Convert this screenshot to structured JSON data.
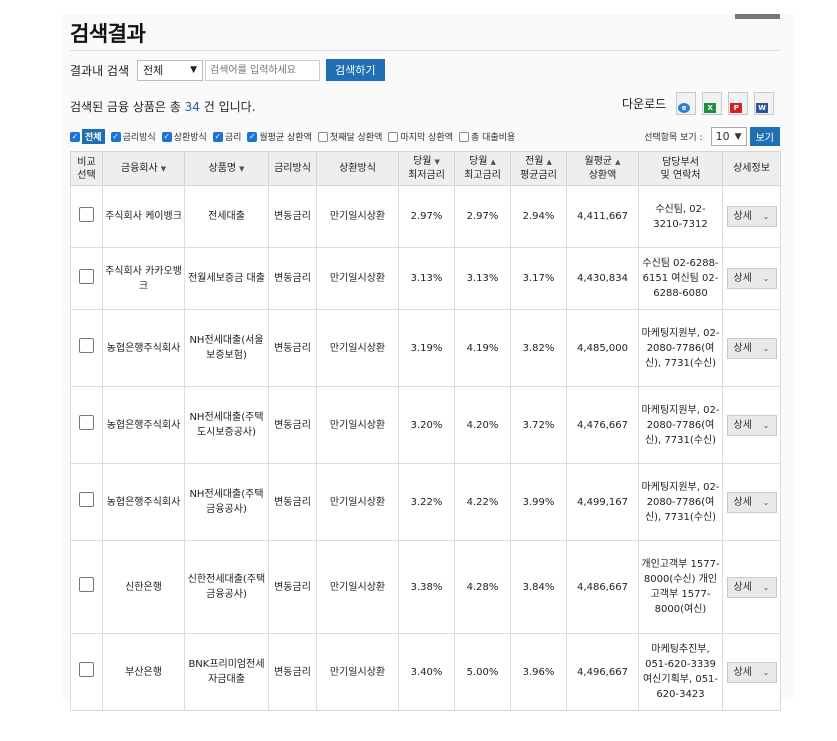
{
  "page": {
    "title": "검색결과"
  },
  "inner_search": {
    "label": "결과내 검색",
    "scope_value": "전체",
    "placeholder": "검색어를 입력하세요",
    "button": "검색하기"
  },
  "summary": {
    "prefix": "검색된 금융 상품은 총 ",
    "count": "34",
    "suffix": " 건 입니다."
  },
  "download": {
    "label": "다운로드",
    "icons": [
      "ie-icon",
      "excel-icon",
      "pdf-icon",
      "word-icon"
    ]
  },
  "filters": [
    {
      "label": "전체",
      "checked": true
    },
    {
      "label": "금리방식",
      "checked": true
    },
    {
      "label": "상환방식",
      "checked": true
    },
    {
      "label": "금리",
      "checked": true
    },
    {
      "label": "월평균 상환액",
      "checked": true
    },
    {
      "label": "첫째달 상환액",
      "checked": false
    },
    {
      "label": "마지막 상환액",
      "checked": false
    },
    {
      "label": "총 대출비용",
      "checked": false
    }
  ],
  "view": {
    "label": "선택항목 보기 :",
    "value": "10",
    "button": "보기"
  },
  "columns": {
    "compare": [
      "비교",
      "선택"
    ],
    "company": "금융회사",
    "product": "상품명",
    "rate_type": "금리방식",
    "repay_type": "상환방식",
    "min_rate": [
      "당월",
      "최저금리"
    ],
    "max_rate": [
      "당월",
      "최고금리"
    ],
    "avg_rate": [
      "전월",
      "평균금리"
    ],
    "monthly": [
      "월평균",
      "상환액"
    ],
    "contact": [
      "담당부서",
      "및 연락처"
    ],
    "detail": "상세정보"
  },
  "rows": [
    {
      "company": "주식회사 케이뱅크",
      "product": "전세대출",
      "rate_type": "변동금리",
      "repay_type": "만기일시상환",
      "min_rate": "2.97%",
      "max_rate": "2.97%",
      "avg_rate": "2.94%",
      "monthly": "4,411,667",
      "contact": "수신팀, 02-3210-7312",
      "detail": "상세"
    },
    {
      "company": "주식회사 카카오뱅크",
      "product": "전월세보증금 대출",
      "rate_type": "변동금리",
      "repay_type": "만기일시상환",
      "min_rate": "3.13%",
      "max_rate": "3.13%",
      "avg_rate": "3.17%",
      "monthly": "4,430,834",
      "contact": "수신팀 02-6288-6151 여신팀 02-6288-6080",
      "detail": "상세"
    },
    {
      "company": "농협은행주식회사",
      "product": "NH전세대출(서울보증보험)",
      "rate_type": "변동금리",
      "repay_type": "만기일시상환",
      "min_rate": "3.19%",
      "max_rate": "4.19%",
      "avg_rate": "3.82%",
      "monthly": "4,485,000",
      "contact": "마케팅지원부, 02-2080-7786(여신), 7731(수신)",
      "detail": "상세"
    },
    {
      "company": "농협은행주식회사",
      "product": "NH전세대출(주택도시보증공사)",
      "rate_type": "변동금리",
      "repay_type": "만기일시상환",
      "min_rate": "3.20%",
      "max_rate": "4.20%",
      "avg_rate": "3.72%",
      "monthly": "4,476,667",
      "contact": "마케팅지원부, 02-2080-7786(여신), 7731(수신)",
      "detail": "상세"
    },
    {
      "company": "농협은행주식회사",
      "product": "NH전세대출(주택금융공사)",
      "rate_type": "변동금리",
      "repay_type": "만기일시상환",
      "min_rate": "3.22%",
      "max_rate": "4.22%",
      "avg_rate": "3.99%",
      "monthly": "4,499,167",
      "contact": "마케팅지원부, 02-2080-7786(여신), 7731(수신)",
      "detail": "상세"
    },
    {
      "company": "신한은행",
      "product": "신한전세대출(주택금융공사)",
      "rate_type": "변동금리",
      "repay_type": "만기일시상환",
      "min_rate": "3.38%",
      "max_rate": "4.28%",
      "avg_rate": "3.84%",
      "monthly": "4,486,667",
      "contact": "개인고객부 1577-8000(수신) 개인고객부 1577-8000(여신)",
      "detail": "상세"
    },
    {
      "company": "부산은행",
      "product": "BNK프리미엄전세자금대출",
      "rate_type": "변동금리",
      "repay_type": "만기일시상환",
      "min_rate": "3.40%",
      "max_rate": "5.00%",
      "avg_rate": "3.96%",
      "monthly": "4,496,667",
      "contact": "마케팅추진부, 051-620-3339 여신기획부, 051-620-3423",
      "detail": "상세"
    }
  ]
}
